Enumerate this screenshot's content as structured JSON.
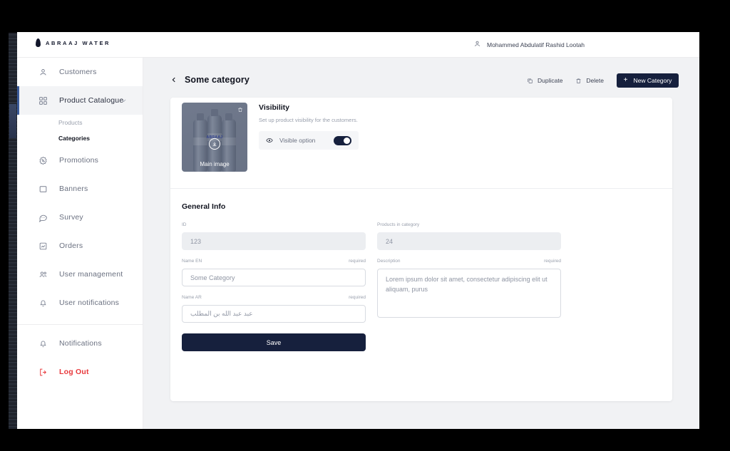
{
  "brand": {
    "name": "ABRAAJ WATER",
    "logo_icon": "water-drop-icon"
  },
  "topbar": {
    "user_icon": "user-icon",
    "user_name": "Mohammed Abdulatif Rashid Lootah"
  },
  "sidebar": {
    "items": [
      {
        "label": "Customers",
        "icon": "user-icon",
        "active": false
      },
      {
        "label": "Product Catalogue",
        "icon": "grid-icon",
        "active": true
      },
      {
        "label": "Promotions",
        "icon": "badge-percent-icon",
        "active": false
      },
      {
        "label": "Banners",
        "icon": "square-icon",
        "active": false
      },
      {
        "label": "Survey",
        "icon": "chat-bubble-icon",
        "active": false
      },
      {
        "label": "Orders",
        "icon": "clipboard-chart-icon",
        "active": false
      },
      {
        "label": "User management",
        "icon": "users-icon",
        "active": false
      },
      {
        "label": "User notifications",
        "icon": "bell-icon",
        "active": false
      }
    ],
    "sub_items": [
      {
        "label": "Products",
        "active": false
      },
      {
        "label": "Categories",
        "active": true
      }
    ],
    "footer_items": [
      {
        "label": "Notifications",
        "icon": "bell-icon"
      },
      {
        "label": "Log Out",
        "icon": "logout-icon"
      }
    ]
  },
  "page": {
    "back_icon": "chevron-left-icon",
    "title": "Some category",
    "actions": {
      "duplicate_label": "Duplicate",
      "duplicate_icon": "copy-icon",
      "delete_label": "Delete",
      "delete_icon": "trash-icon",
      "new_category_label": "New Category",
      "new_category_plus": "+"
    }
  },
  "media": {
    "caption": "Main image",
    "thumb_brand_text": "ABRAAJ",
    "delete_icon": "trash-icon",
    "upload_icon": "download-icon"
  },
  "visibility": {
    "title": "Visibility",
    "subtitle": "Set up product visibility for the customers.",
    "option_label": "Visible option",
    "option_icon": "eye-icon",
    "option_enabled": "on"
  },
  "general_info": {
    "title": "General Info",
    "fields": {
      "id": {
        "label": "ID",
        "value": "123",
        "required_text": ""
      },
      "products_in_category": {
        "label": "Products in category",
        "value": "24",
        "required_text": ""
      },
      "name_en": {
        "label": "Name EN",
        "value": "Some Category",
        "required_text": "required"
      },
      "description": {
        "label": "Description",
        "value": "Lorem ipsum dolor sit amet, consectetur adipiscing elit ut aliquam, purus",
        "required_text": "required"
      },
      "name_ar": {
        "label": "Name AR",
        "value": "عبد عبد الله بن المطلب",
        "required_text": "required"
      }
    },
    "save_label": "Save"
  },
  "colors": {
    "accent_dark": "#16203d",
    "danger": "#e8393c",
    "active_bar": "#3b5b9a",
    "page_bg": "#f1f2f4"
  }
}
